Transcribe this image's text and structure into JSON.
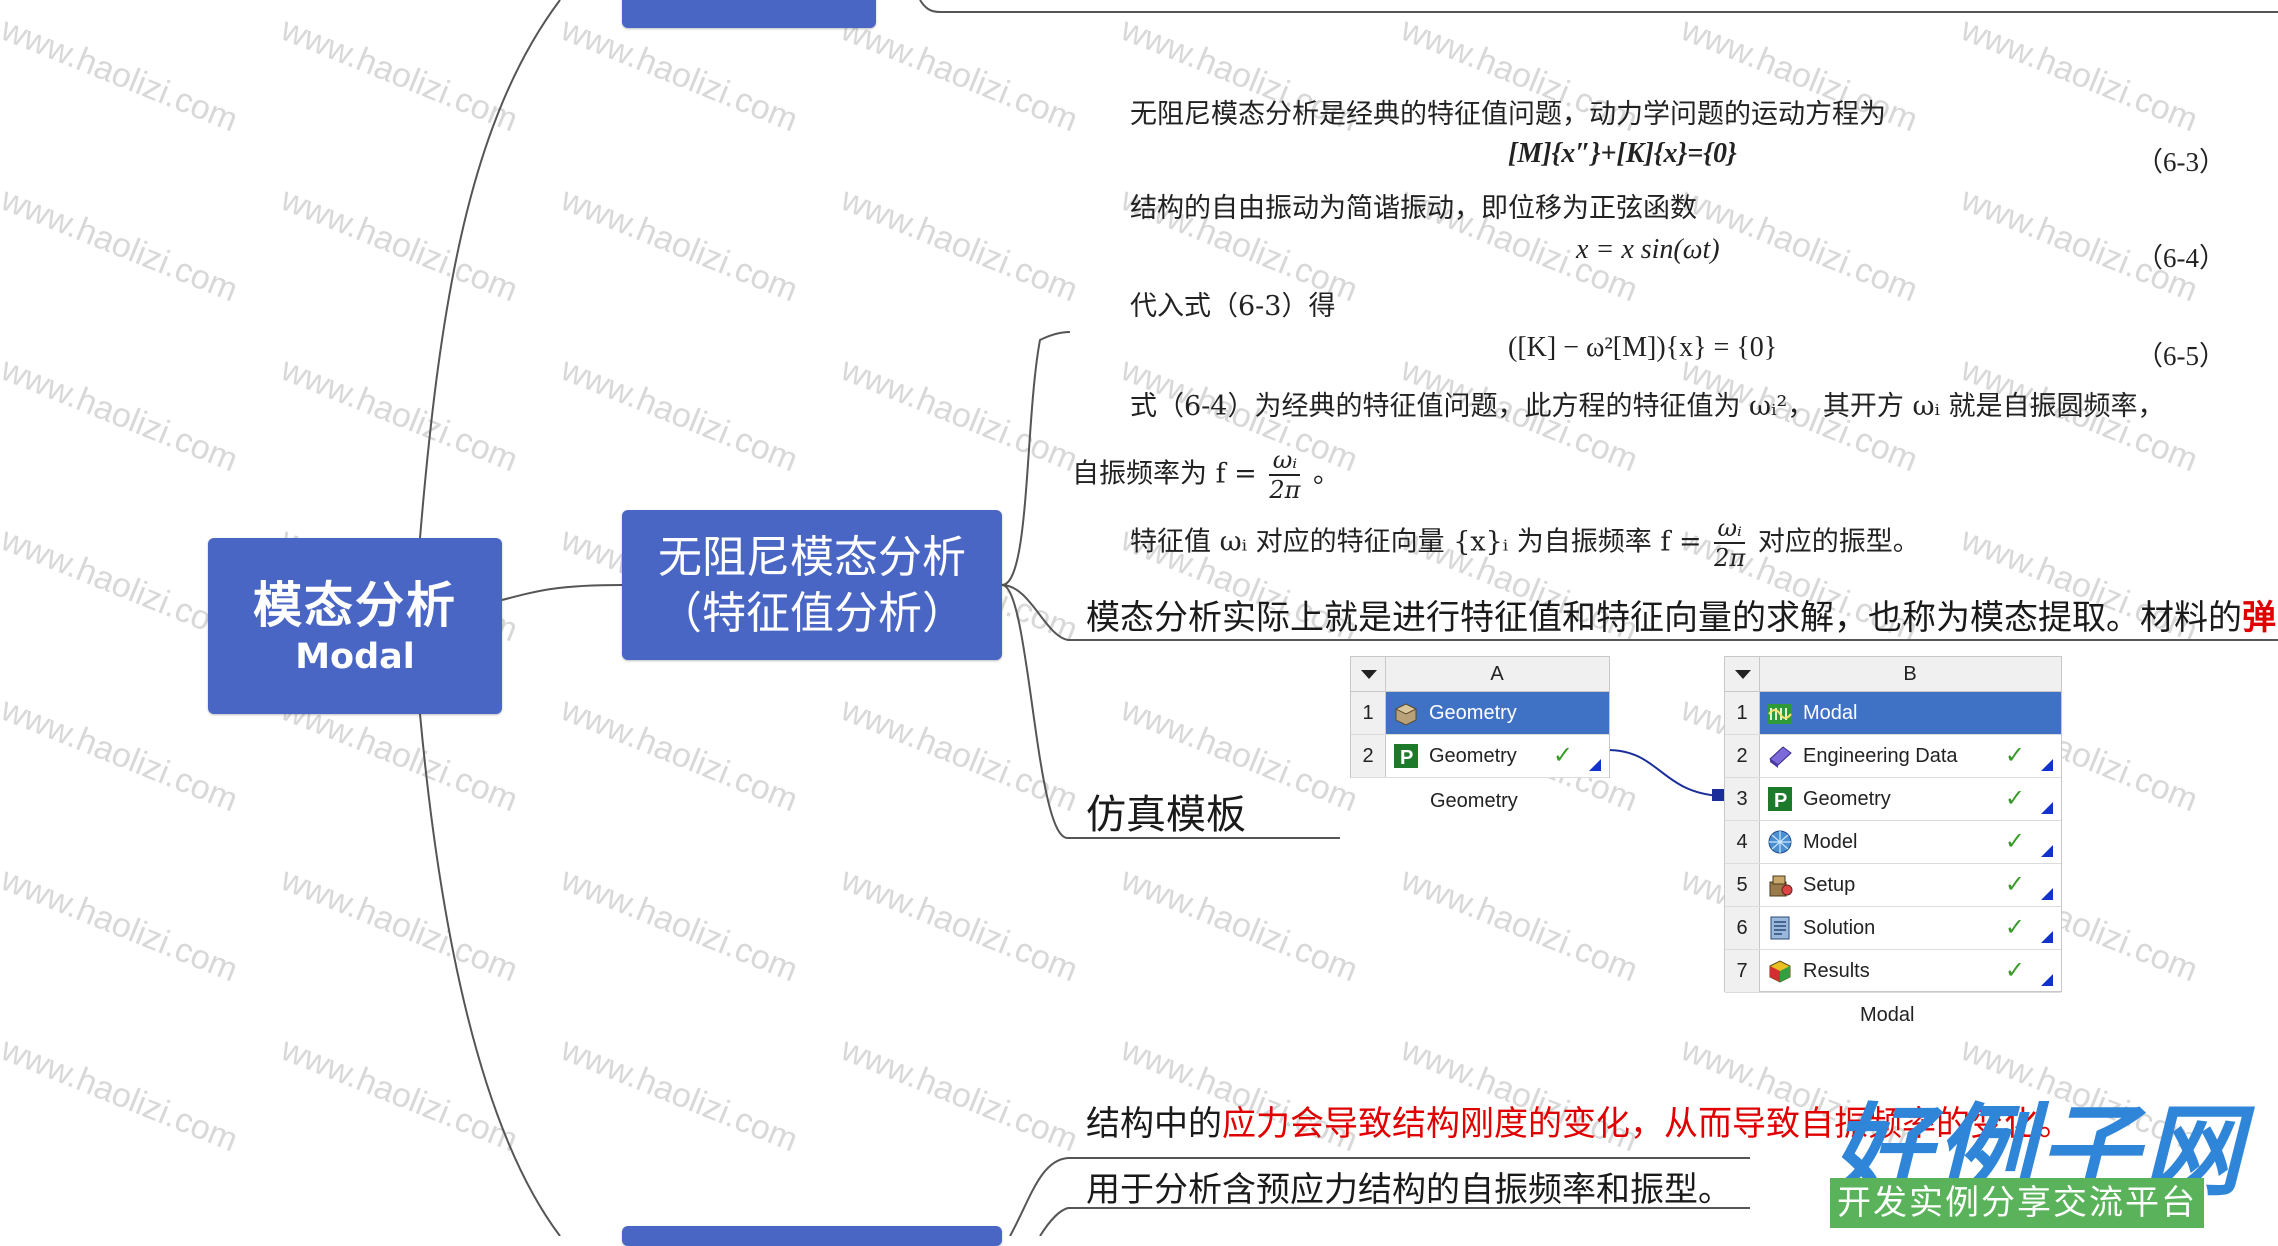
{
  "mindmap": {
    "root_title": "模态分析",
    "root_subtitle": "Modal",
    "node_line1": "无阻尼模态分析",
    "node_line2": "（特征值分析）"
  },
  "textbook": {
    "p1": "无阻尼模态分析是经典的特征值问题，动力学问题的运动方程为",
    "eq1": "[M]{x″}+[K]{x}={0}",
    "eq1_num": "（6-3）",
    "p2": "结构的自由振动为简谐振动，即位移为正弦函数",
    "eq2": "x = x sin(ωt)",
    "eq2_num": "（6-4）",
    "p3": "代入式（6-3）得",
    "eq3": "([K] − ω²[M]){x} = {0}",
    "eq3_num": "（6-5）",
    "p4": "式（6-4）为经典的特征值问题，此方程的特征值为 ωᵢ²， 其开方 ωᵢ 就是自振圆频率，",
    "p5_prefix": "自振频率为 f =",
    "p5_frac_num": "ωᵢ",
    "p5_frac_den": "2π",
    "p5_suffix": "。",
    "p6_prefix": "特征值 ωᵢ 对应的特征向量 {x}ᵢ 为自振频率 f =",
    "p6_frac_num": "ωᵢ",
    "p6_frac_den": "2π",
    "p6_suffix": "对应的振型。"
  },
  "notes": {
    "modal_note": "模态分析实际上就是进行特征值和特征向量的求解，也称为模态提取。材料的",
    "modal_note_red": "弹",
    "template_label": "仿真模板",
    "prestress_prefix": "结构中的",
    "prestress_red": "应力会导致结构刚度的变化，从而导致自振频率的变化。",
    "prestress_use": "用于分析含预应力结构的自振频率和振型。"
  },
  "panel_a": {
    "header": "A",
    "caption": "Geometry",
    "rows": [
      {
        "num": "1",
        "label": "Geometry",
        "icon": "geometry-box-icon"
      },
      {
        "num": "2",
        "label": "Geometry",
        "icon": "p-geometry-icon"
      }
    ]
  },
  "panel_b": {
    "header": "B",
    "caption": "Modal",
    "rows": [
      {
        "num": "1",
        "label": "Modal",
        "icon": "modal-icon"
      },
      {
        "num": "2",
        "label": "Engineering Data",
        "icon": "engineering-data-icon"
      },
      {
        "num": "3",
        "label": "Geometry",
        "icon": "p-geometry-icon"
      },
      {
        "num": "4",
        "label": "Model",
        "icon": "model-mesh-icon"
      },
      {
        "num": "5",
        "label": "Setup",
        "icon": "setup-icon"
      },
      {
        "num": "6",
        "label": "Solution",
        "icon": "solution-icon"
      },
      {
        "num": "7",
        "label": "Results",
        "icon": "results-icon"
      }
    ],
    "check": "✓"
  },
  "watermark": "www.haolizi.com",
  "logo": {
    "main": "好例子网",
    "sub": "开发实例分享交流平台"
  },
  "colors": {
    "node_blue": "#4a66c4",
    "highlight_red": "#e00000",
    "selected_row": "#3f72c4",
    "check_green": "#3a9b2a",
    "logo_blue": "#2f86d8",
    "logo_green": "#5ab35a"
  }
}
